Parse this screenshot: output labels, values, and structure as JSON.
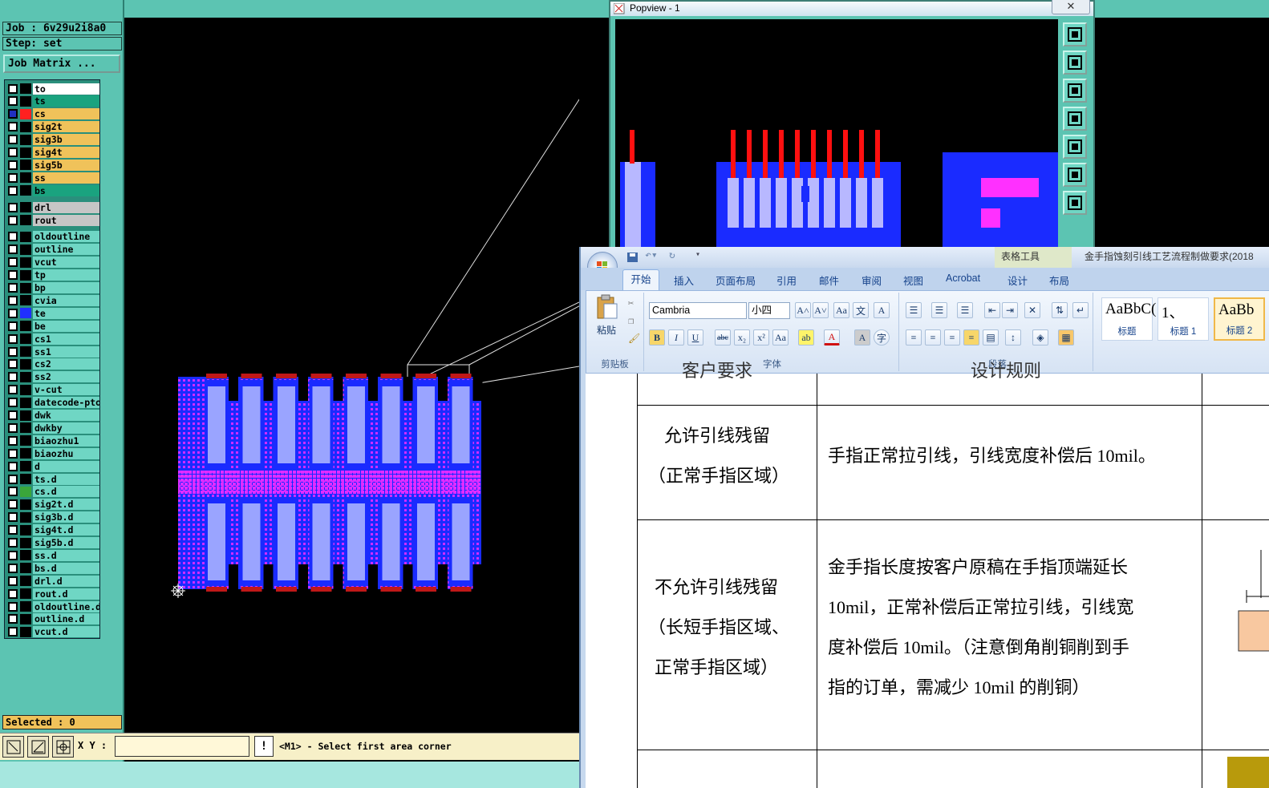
{
  "top_strip_text": "_ ~~ ... _ ~~ _",
  "job": {
    "job_line": "Job : 6v29u2i8a0",
    "step_line": "Step: set",
    "matrix_button": "Job Matrix ..."
  },
  "layers": [
    {
      "name": "to",
      "color": "#ffffff",
      "swatch": "#000000"
    },
    {
      "name": "ts",
      "color": "#1aa37f",
      "swatch": "#000000"
    },
    {
      "name": "cs",
      "color": "#f0c25a",
      "swatch": "#ff2020",
      "active": true
    },
    {
      "name": "sig2t",
      "color": "#f0c25a",
      "swatch": "#000000"
    },
    {
      "name": "sig3b",
      "color": "#f0c25a",
      "swatch": "#000000"
    },
    {
      "name": "sig4t",
      "color": "#f0c25a",
      "swatch": "#000000"
    },
    {
      "name": "sig5b",
      "color": "#f0c25a",
      "swatch": "#000000"
    },
    {
      "name": "ss",
      "color": "#f0c25a",
      "swatch": "#000000"
    },
    {
      "name": "bs",
      "color": "#1aa37f",
      "swatch": "#000000"
    },
    {
      "name": "drl",
      "color": "#c6c6c6",
      "swatch": "#000000",
      "gap": true
    },
    {
      "name": "rout",
      "color": "#c6c6c6",
      "swatch": "#000000"
    },
    {
      "name": "oldoutline",
      "color": "#6fd6c4",
      "swatch": "#000000",
      "gap": true
    },
    {
      "name": "outline",
      "color": "#6fd6c4",
      "swatch": "#000000"
    },
    {
      "name": "vcut",
      "color": "#6fd6c4",
      "swatch": "#000000"
    },
    {
      "name": "tp",
      "color": "#6fd6c4",
      "swatch": "#000000"
    },
    {
      "name": "bp",
      "color": "#6fd6c4",
      "swatch": "#000000"
    },
    {
      "name": "cvia",
      "color": "#6fd6c4",
      "swatch": "#000000"
    },
    {
      "name": "te",
      "color": "#6fd6c4",
      "swatch": "#2030ff"
    },
    {
      "name": "be",
      "color": "#6fd6c4",
      "swatch": "#000000"
    },
    {
      "name": "cs1",
      "color": "#6fd6c4",
      "swatch": "#000000"
    },
    {
      "name": "ss1",
      "color": "#6fd6c4",
      "swatch": "#000000"
    },
    {
      "name": "cs2",
      "color": "#6fd6c4",
      "swatch": "#000000"
    },
    {
      "name": "ss2",
      "color": "#6fd6c4",
      "swatch": "#000000"
    },
    {
      "name": "v-cut",
      "color": "#6fd6c4",
      "swatch": "#000000"
    },
    {
      "name": "datecode-pto",
      "color": "#6fd6c4",
      "swatch": "#000000"
    },
    {
      "name": "dwk",
      "color": "#6fd6c4",
      "swatch": "#000000"
    },
    {
      "name": "dwkby",
      "color": "#6fd6c4",
      "swatch": "#000000"
    },
    {
      "name": "biaozhu1",
      "color": "#6fd6c4",
      "swatch": "#000000"
    },
    {
      "name": "biaozhu",
      "color": "#6fd6c4",
      "swatch": "#000000"
    },
    {
      "name": "d",
      "color": "#6fd6c4",
      "swatch": "#000000"
    },
    {
      "name": "ts.d",
      "color": "#6fd6c4",
      "swatch": "#000000"
    },
    {
      "name": "cs.d",
      "color": "#6fd6c4",
      "swatch": "#3aa63a"
    },
    {
      "name": "sig2t.d",
      "color": "#6fd6c4",
      "swatch": "#000000"
    },
    {
      "name": "sig3b.d",
      "color": "#6fd6c4",
      "swatch": "#000000"
    },
    {
      "name": "sig4t.d",
      "color": "#6fd6c4",
      "swatch": "#000000"
    },
    {
      "name": "sig5b.d",
      "color": "#6fd6c4",
      "swatch": "#000000"
    },
    {
      "name": "ss.d",
      "color": "#6fd6c4",
      "swatch": "#000000"
    },
    {
      "name": "bs.d",
      "color": "#6fd6c4",
      "swatch": "#000000"
    },
    {
      "name": "drl.d",
      "color": "#6fd6c4",
      "swatch": "#000000"
    },
    {
      "name": "rout.d",
      "color": "#6fd6c4",
      "swatch": "#000000"
    },
    {
      "name": "oldoutline.d",
      "color": "#6fd6c4",
      "swatch": "#000000"
    },
    {
      "name": "outline.d",
      "color": "#6fd6c4",
      "swatch": "#000000"
    },
    {
      "name": "vcut.d",
      "color": "#6fd6c4",
      "swatch": "#000000"
    }
  ],
  "selected": "Selected : 0",
  "bottombar": {
    "xy_label": "X Y :",
    "xy_value": "",
    "warn_symbol": "!",
    "prompt": "<M1> - Select first area corner"
  },
  "popview": {
    "title": "Popview - 1",
    "close": "✕"
  },
  "word": {
    "context_tab": "表格工具",
    "doc_title": "金手指蚀刻引线工艺流程制做要求(2018",
    "tabs": [
      "开始",
      "插入",
      "页面布局",
      "引用",
      "邮件",
      "审阅",
      "视图",
      "Acrobat",
      "设计",
      "布局"
    ],
    "paste_label": "粘贴",
    "clipboard_label": "剪贴板",
    "font_name": "Cambria",
    "font_size": "小四",
    "font_group_label": "字体",
    "para_group_label": "段落",
    "styles": [
      {
        "preview": "AaBbC(",
        "name": "标题"
      },
      {
        "preview": "1、",
        "name": "标题 1"
      },
      {
        "preview": "AaBb",
        "name": "标题 2"
      }
    ],
    "table": {
      "header_left": "客户要求",
      "header_mid": "设计规则",
      "row1_left_a": "允许引线残留",
      "row1_left_b": "（正常手指区域）",
      "row1_right": "手指正常拉引线，引线宽度补偿后 10mil。",
      "row2_left_a": "不允许引线残留",
      "row2_left_b": "（长短手指区域、",
      "row2_left_c": "正常手指区域）",
      "row2_right_1": "金手指长度按客户原稿在手指顶端延长",
      "row2_right_2": "10mil，正常补偿后正常拉引线，引线宽",
      "row2_right_3": "度补偿后 10mil。（注意倒角削铜削到手",
      "row2_right_4": "指的订单，需减少 10mil 的削铜）"
    }
  }
}
